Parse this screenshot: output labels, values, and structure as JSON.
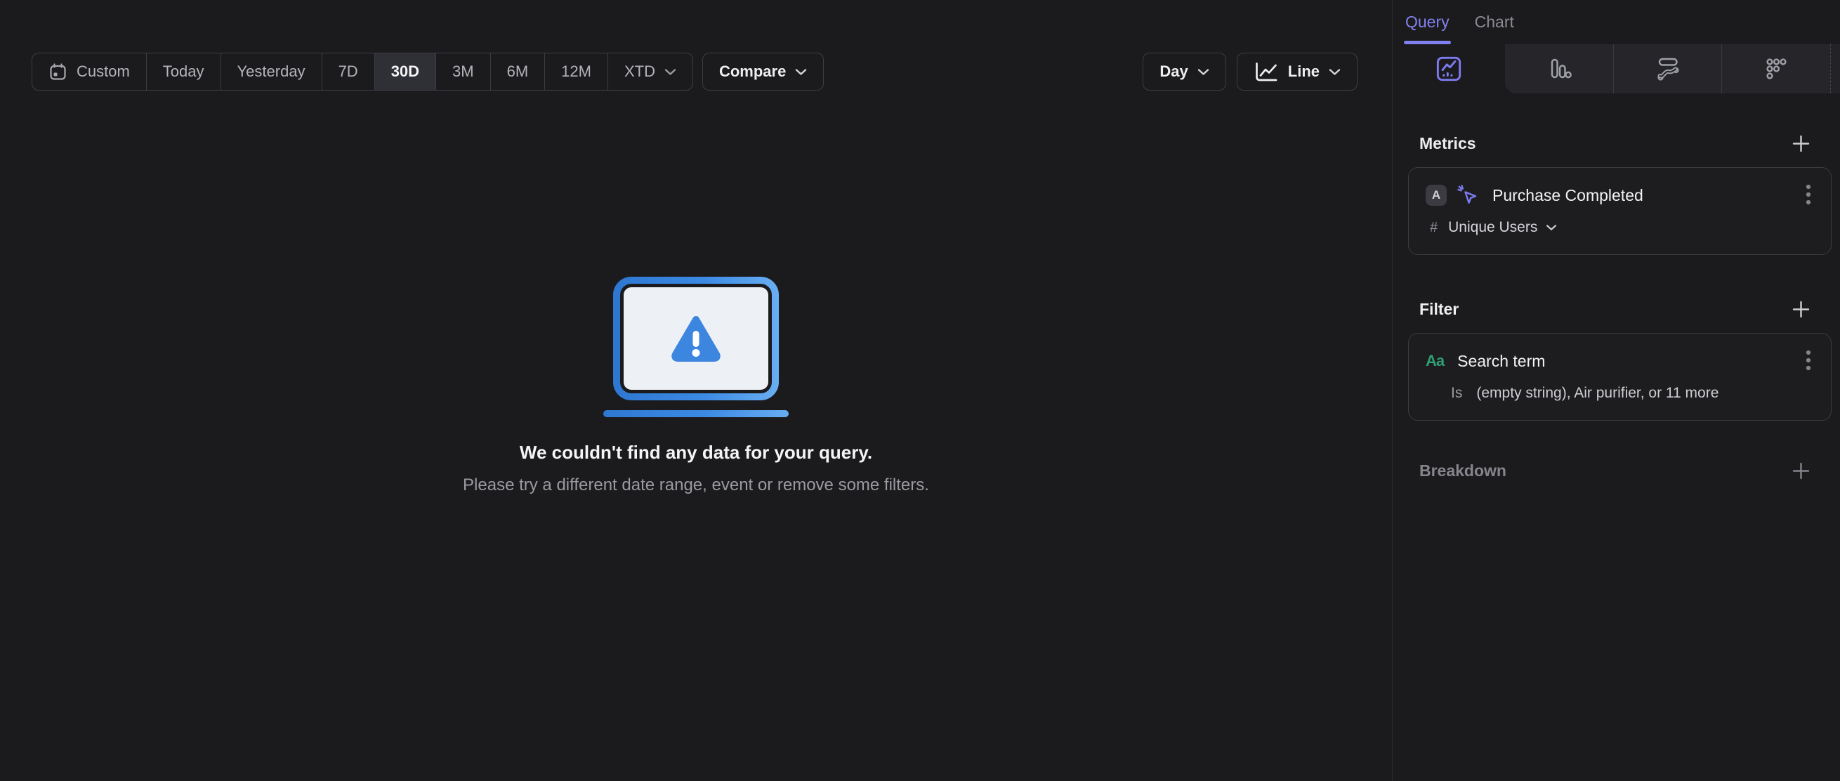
{
  "colors": {
    "page_bg": "#1b1b1e",
    "strip_bg": "#26262a",
    "accent_purple": "#8280ee",
    "icon_purple": "#7d7bf0",
    "green": "#2f9e73",
    "blue_dark": "#2e78d2",
    "blue": "#3c86e0",
    "blue_light": "#67adf2",
    "screen_gray": "#edf1f6"
  },
  "toolbar": {
    "date_range_segments": [
      {
        "label": "Custom",
        "icon": "calendar-icon"
      },
      {
        "label": "Today"
      },
      {
        "label": "Yesterday"
      },
      {
        "label": "7D"
      },
      {
        "label": "30D",
        "selected": true
      },
      {
        "label": "3M"
      },
      {
        "label": "6M"
      },
      {
        "label": "12M"
      },
      {
        "label": "XTD",
        "icon": "chevron-down-icon"
      }
    ],
    "compare_label": "Compare",
    "granularity_label": "Day",
    "chart_type_label": "Line"
  },
  "empty_state": {
    "title": "We couldn't find any data for your query.",
    "subtitle": "Please try a different date range, event or remove some filters."
  },
  "sidebar": {
    "tabs": [
      {
        "label": "Query",
        "active": true
      },
      {
        "label": "Chart",
        "active": false
      }
    ],
    "chart_type_tabs": [
      {
        "icon": "insights-line-chart-icon",
        "selected": true
      },
      {
        "icon": "bar-chart-icon",
        "selected": false
      },
      {
        "icon": "flow-chart-icon",
        "selected": false
      },
      {
        "icon": "metric-grid-icon",
        "selected": false
      }
    ],
    "metrics": {
      "heading": "Metrics",
      "items": [
        {
          "letter_badge": "A",
          "event_icon": "cursor-click-icon",
          "name": "Purchase Completed",
          "aggregation_symbol": "#",
          "aggregation": "Unique Users"
        }
      ]
    },
    "filter": {
      "heading": "Filter",
      "items": [
        {
          "type_badge": "Aa",
          "name": "Search term",
          "operator": "Is",
          "value": "(empty string), Air purifier, or 11 more"
        }
      ]
    },
    "breakdown": {
      "heading": "Breakdown"
    }
  }
}
